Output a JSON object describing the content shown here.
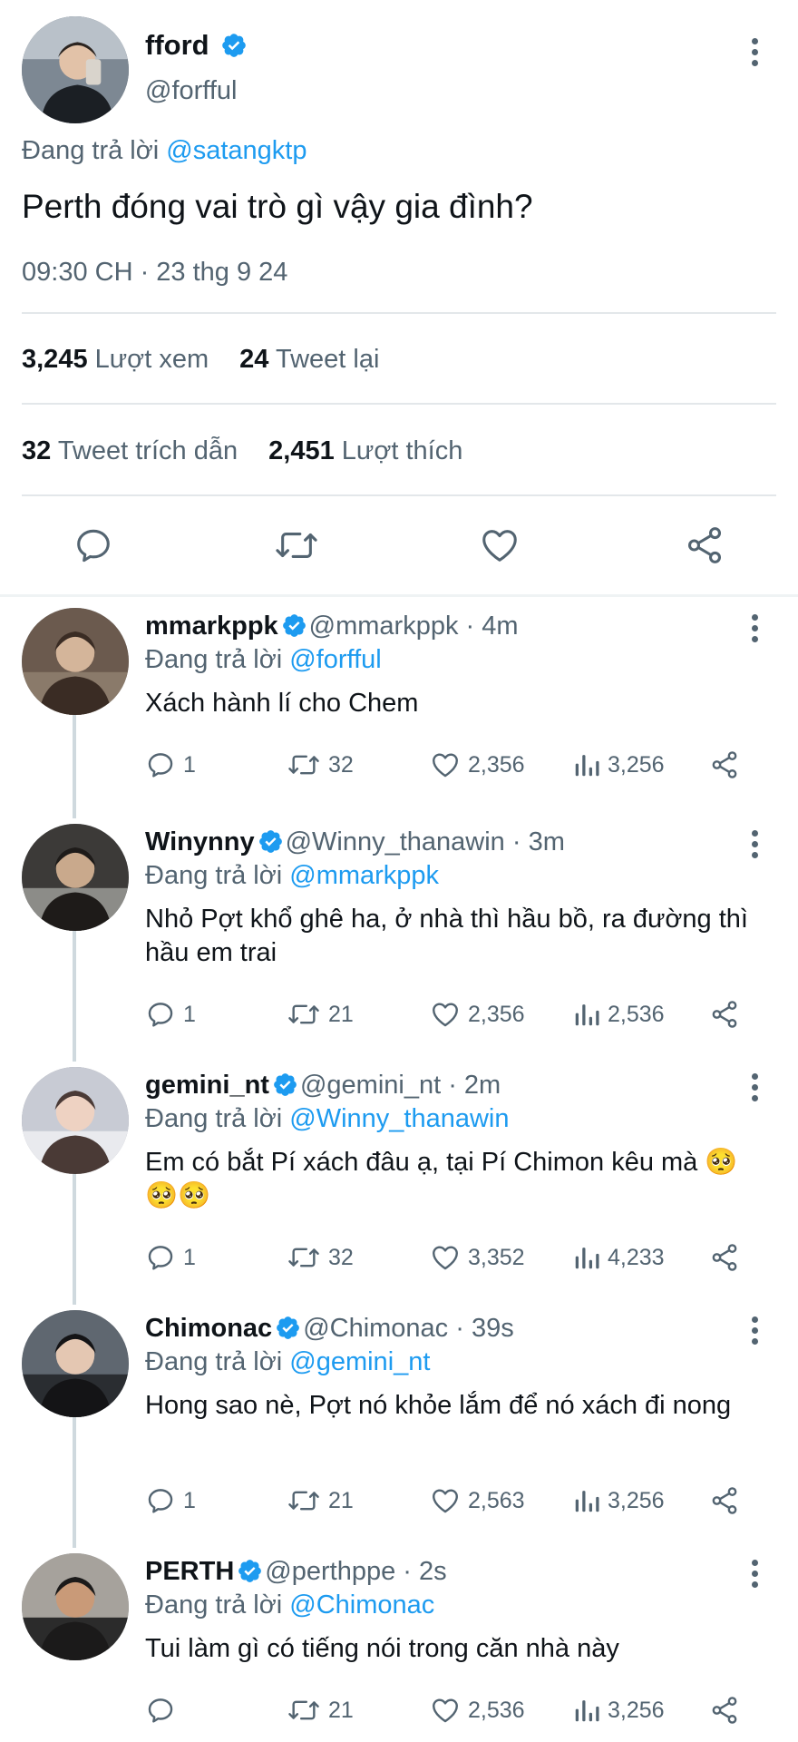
{
  "main_tweet": {
    "display_name": "fford",
    "handle": "@forfful",
    "replying_prefix": "Đang trả lời",
    "replying_to": "@satangktp",
    "text": "Perth đóng vai trò gì vậy gia đình?",
    "timestamp": "09:30 CH · 23 thg 9 24",
    "views_count": "3,245",
    "views_label": "Lượt xem",
    "retweets_count": "24",
    "retweets_label": "Tweet lại",
    "quotes_count": "32",
    "quotes_label": "Tweet trích dẫn",
    "likes_count": "2,451",
    "likes_label": "Lượt thích"
  },
  "replies": [
    {
      "display_name": "mmarkppk",
      "handle": "@mmarkppk",
      "time": "· 4m",
      "replying_prefix": "Đang trả lời",
      "replying_to": "@forfful",
      "text": "Xách hành lí cho Chem",
      "reply_count": "1",
      "retweet_count": "32",
      "like_count": "2,356",
      "view_count": "3,256"
    },
    {
      "display_name": "Winynny",
      "handle": "@Winny_thanawin",
      "time": "· 3m",
      "replying_prefix": "Đang trả lời",
      "replying_to": "@mmarkppk",
      "text": "Nhỏ Pợt khổ ghê ha, ở nhà thì hầu bồ, ra đường thì hầu em trai",
      "reply_count": "1",
      "retweet_count": "21",
      "like_count": "2,356",
      "view_count": "2,536"
    },
    {
      "display_name": "gemini_nt",
      "handle": "@gemini_nt",
      "time": "· 2m",
      "replying_prefix": "Đang trả lời",
      "replying_to": "@Winny_thanawin",
      "text": "Em có bắt Pí xách đâu ạ, tại Pí Chimon kêu mà 🥺🥺🥺",
      "reply_count": "1",
      "retweet_count": "32",
      "like_count": "3,352",
      "view_count": "4,233"
    },
    {
      "display_name": "Chimonac",
      "handle": "@Chimonac",
      "time": "· 39s",
      "replying_prefix": "Đang trả lời",
      "replying_to": "@gemini_nt",
      "text": "Hong sao nè, Pợt nó khỏe lắm để nó xách đi nong",
      "reply_count": "1",
      "retweet_count": "21",
      "like_count": "2,563",
      "view_count": "3,256"
    },
    {
      "display_name": "PERTH",
      "handle": "@perthppe",
      "time": "· 2s",
      "replying_prefix": "Đang trả lời",
      "replying_to": "@Chimonac",
      "text": "Tui làm gì có tiếng nói trong căn nhà này",
      "reply_count": "",
      "retweet_count": "21",
      "like_count": "2,536",
      "view_count": "3,256"
    }
  ],
  "icons": {
    "verified": "verified-badge-icon",
    "more": "more-vertical-icon",
    "reply": "reply-icon",
    "retweet": "retweet-icon",
    "like": "heart-icon",
    "views": "views-icon",
    "share": "share-icon"
  },
  "colors": {
    "accent": "#1d9bf0",
    "text": "#0f1419",
    "muted": "#536471",
    "divider": "#e3e7ea",
    "thread_line": "#cfd9de"
  }
}
